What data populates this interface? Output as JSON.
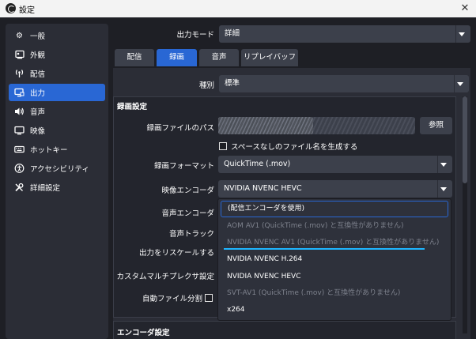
{
  "window": {
    "title": "設定",
    "close_icon": "close-icon"
  },
  "sidebar": {
    "items": [
      {
        "label": "一般",
        "icon": "gear-icon"
      },
      {
        "label": "外観",
        "icon": "palette-icon"
      },
      {
        "label": "配信",
        "icon": "antenna-icon"
      },
      {
        "label": "出力",
        "icon": "monitor-output-icon",
        "active": true
      },
      {
        "label": "音声",
        "icon": "speaker-icon"
      },
      {
        "label": "映像",
        "icon": "display-icon"
      },
      {
        "label": "ホットキー",
        "icon": "keyboard-icon"
      },
      {
        "label": "アクセシビリティ",
        "icon": "accessibility-icon"
      },
      {
        "label": "詳細設定",
        "icon": "tools-icon"
      }
    ]
  },
  "output_mode": {
    "label": "出力モード",
    "value": "詳細"
  },
  "tabs": [
    {
      "label": "配信"
    },
    {
      "label": "録画",
      "active": true
    },
    {
      "label": "音声"
    },
    {
      "label": "リプレイバッファ"
    }
  ],
  "type": {
    "label": "種別",
    "value": "標準"
  },
  "recording": {
    "section_title": "録画設定",
    "path_label": "録画ファイルのパス",
    "browse_button": "参照",
    "no_space_checkbox": "スペースなしのファイル名を生成する",
    "format_label": "録画フォーマット",
    "format_value": "QuickTime (.mov)",
    "video_encoder_label": "映像エンコーダ",
    "video_encoder_value": "NVIDIA NVENC HEVC",
    "audio_encoder_label": "音声エンコーダ",
    "audio_track_label": "音声トラック",
    "rescale_label": "出力をリスケールする",
    "muxer_label": "カスタムマルチプレクサ設定",
    "auto_split_label": "自動ファイル分割"
  },
  "encoder_section": {
    "title": "エンコーダ設定"
  },
  "encoder_dropdown": {
    "options": [
      {
        "label": "(配信エンコーダを使用)",
        "state": "selected"
      },
      {
        "label": "AOM AV1 (QuickTime (.mov) と互換性がありません)",
        "state": "disabled"
      },
      {
        "label": "NVIDIA NVENC AV1 (QuickTime (.mov) と互換性がありません)",
        "state": "disabled"
      },
      {
        "label": "NVIDIA NVENC H.264",
        "state": "enabled"
      },
      {
        "label": "NVIDIA NVENC HEVC",
        "state": "enabled"
      },
      {
        "label": "SVT-AV1 (QuickTime (.mov) と互換性がありません)",
        "state": "disabled"
      },
      {
        "label": "x264",
        "state": "enabled"
      }
    ]
  },
  "colors": {
    "accent": "#2967d4",
    "highlight_line": "#1fb6ff",
    "background": "#1e1f25",
    "panel": "#2b2d36"
  }
}
